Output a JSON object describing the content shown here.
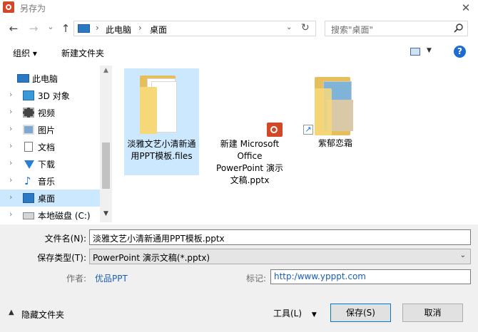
{
  "window": {
    "title": "另存为",
    "close_glyph": "✕"
  },
  "nav": {
    "back_glyph": "←",
    "forward_glyph": "→",
    "history_glyph": "⌄",
    "up_glyph": "↑",
    "breadcrumb": [
      "此电脑",
      "桌面"
    ],
    "crumb_sep": "›",
    "dropdown_glyph": "⌄",
    "refresh_glyph": "↻",
    "search_placeholder": "搜索\"桌面\""
  },
  "toolbar": {
    "organize_label": "组织 ▾",
    "new_folder_label": "新建文件夹",
    "view_drop_glyph": "▼",
    "help_glyph": "?"
  },
  "sidebar": {
    "items": [
      {
        "label": "此电脑",
        "icon": "computer-icon"
      },
      {
        "label": "3D 对象",
        "icon": "cube-icon"
      },
      {
        "label": "视频",
        "icon": "video-icon"
      },
      {
        "label": "图片",
        "icon": "pictures-icon"
      },
      {
        "label": "文档",
        "icon": "document-icon"
      },
      {
        "label": "下载",
        "icon": "download-icon"
      },
      {
        "label": "音乐",
        "icon": "music-icon"
      },
      {
        "label": "桌面",
        "icon": "desktop-icon"
      },
      {
        "label": "本地磁盘 (C:)",
        "icon": "drive-icon"
      }
    ],
    "chevron": "›"
  },
  "files": [
    {
      "name": "淡雅文艺小清新通用PPT模板.files",
      "icon": "folder-icon"
    },
    {
      "name": "新建 Microsoft Office PowerPoint 演示文稿.pptx",
      "icon": "powerpoint-icon"
    },
    {
      "name": "紫郁恋霜",
      "icon": "folder-shortcut-icon"
    }
  ],
  "form": {
    "filename_label": "文件名(N):",
    "filename_value": "淡雅文艺小清新通用PPT模板.pptx",
    "filetype_label": "保存类型(T):",
    "filetype_value": "PowerPoint 演示文稿(*.pptx)",
    "author_label": "作者:",
    "author_value": "优品PPT",
    "tags_label": "标记:",
    "tags_value": "http:/www.ypppt.com"
  },
  "footer": {
    "hide_folders_label": "隐藏文件夹",
    "tools_label": "工具(L)",
    "save_label": "保存(S)",
    "cancel_label": "取消"
  },
  "colors": {
    "selected_bg": "#cce8ff",
    "accent": "#0078d7",
    "form_bg": "#f0f0f0"
  }
}
